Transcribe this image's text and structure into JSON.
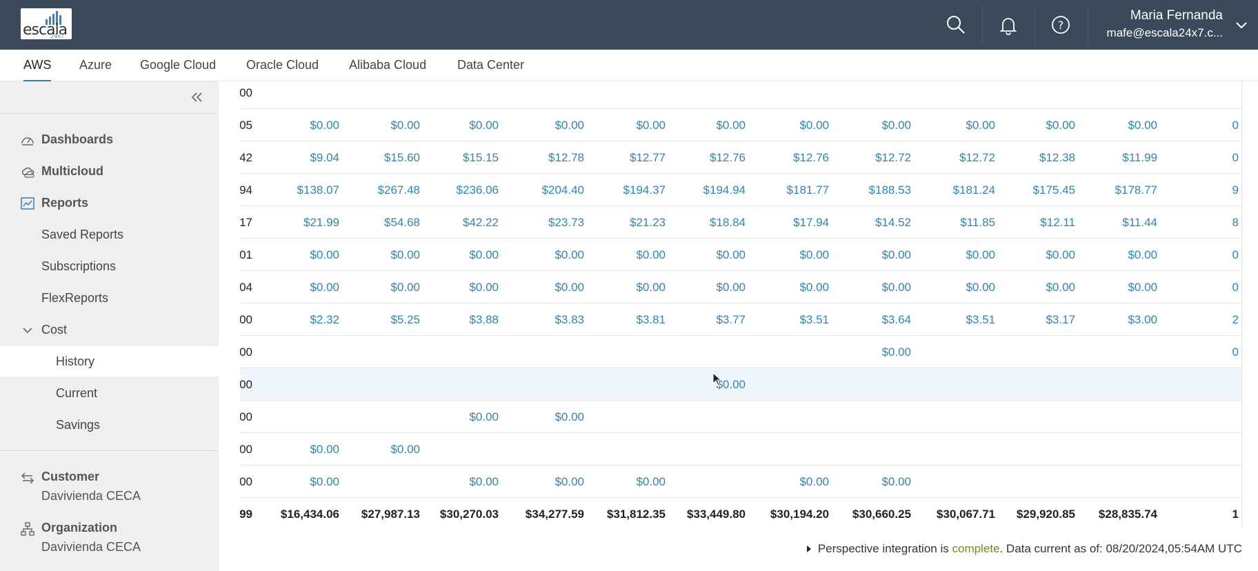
{
  "header": {
    "logo_text": "escala",
    "logo_sub": "24x7",
    "user_name": "Maria Fernanda",
    "user_email": "mafe@escala24x7.c...",
    "icons": [
      "search-icon",
      "bell-icon",
      "help-icon",
      "chevron-down-icon"
    ]
  },
  "tabs": [
    {
      "label": "AWS",
      "active": true
    },
    {
      "label": "Azure"
    },
    {
      "label": "Google Cloud"
    },
    {
      "label": "Oracle Cloud"
    },
    {
      "label": "Alibaba Cloud"
    },
    {
      "label": "Data Center"
    }
  ],
  "sidebar": {
    "items": [
      {
        "label": "Dashboards",
        "icon": "dashboard-icon"
      },
      {
        "label": "Multicloud",
        "icon": "multicloud-icon"
      },
      {
        "label": "Reports",
        "icon": "chart-icon"
      },
      {
        "label": "Saved Reports"
      },
      {
        "label": "Subscriptions"
      },
      {
        "label": "FlexReports"
      },
      {
        "label": "Cost",
        "icon": "chevron-down-icon"
      },
      {
        "label": "History",
        "active": true
      },
      {
        "label": "Current"
      },
      {
        "label": "Savings"
      }
    ],
    "customer": {
      "title": "Customer",
      "value": "Davivienda CECA",
      "icon": "swap-icon"
    },
    "organization": {
      "title": "Organization",
      "value": "Davivienda CECA",
      "icon": "org-icon"
    }
  },
  "table": {
    "rows": [
      [
        "",
        "",
        "",
        "",
        "",
        "",
        "",
        "",
        "",
        "",
        "",
        "",
        "$0.00"
      ],
      [
        "0",
        "$0.00",
        "$0.00",
        "$0.00",
        "$0.00",
        "$0.00",
        "$0.00",
        "$0.00",
        "$0.00",
        "$0.00",
        "$0.00",
        "$0.00",
        "$0.05"
      ],
      [
        "0",
        "$11.99",
        "$12.38",
        "$12.72",
        "$12.72",
        "$12.76",
        "$12.76",
        "$12.77",
        "$12.78",
        "$15.15",
        "$15.60",
        "$9.04",
        "$164.42"
      ],
      [
        "9",
        "$178.77",
        "$175.45",
        "$181.24",
        "$188.53",
        "$181.77",
        "$194.94",
        "$194.37",
        "$204.40",
        "$236.06",
        "$267.48",
        "$138.07",
        "$2,486.94"
      ],
      [
        "8",
        "$11.44",
        "$12.11",
        "$11.85",
        "$14.52",
        "$17.94",
        "$18.84",
        "$21.23",
        "$23.73",
        "$42.22",
        "$54.68",
        "$21.99",
        "$273.17"
      ],
      [
        "0",
        "$0.00",
        "$0.00",
        "$0.00",
        "$0.00",
        "$0.00",
        "$0.00",
        "$0.00",
        "$0.00",
        "$0.00",
        "$0.00",
        "$0.00",
        "$0.01"
      ],
      [
        "0",
        "$0.00",
        "$0.00",
        "$0.00",
        "$0.00",
        "$0.00",
        "$0.00",
        "$0.00",
        "$0.00",
        "$0.00",
        "$0.00",
        "$0.00",
        "$0.04"
      ],
      [
        "2",
        "$3.00",
        "$3.17",
        "$3.51",
        "$3.64",
        "$3.51",
        "$3.77",
        "$3.81",
        "$3.83",
        "$3.88",
        "$5.25",
        "$2.32",
        "$40.00"
      ],
      [
        "0",
        "",
        "",
        "",
        "$0.00",
        "",
        "",
        "",
        "",
        "",
        "",
        "",
        "$0.00"
      ],
      [
        "",
        "",
        "",
        "",
        "",
        "",
        "$0.00",
        "",
        "",
        "",
        "",
        "",
        "$0.00"
      ],
      [
        "",
        "",
        "",
        "",
        "",
        "",
        "",
        "",
        "$0.00",
        "$0.00",
        "",
        "",
        "$0.00"
      ],
      [
        "",
        "",
        "",
        "",
        "",
        "",
        "",
        "",
        "",
        "",
        "$0.00",
        "$0.00",
        "$0.00"
      ],
      [
        "",
        "",
        "",
        "",
        "$0.00",
        "$0.00",
        "",
        "$0.00",
        "$0.00",
        "$0.00",
        "",
        "$0.00",
        "$0.00"
      ]
    ],
    "totals": [
      "1",
      "$28,835.74",
      "$29,920.85",
      "$30,067.71",
      "$30,660.25",
      "$30,194.20",
      "$33,449.80",
      "$31,812.35",
      "$34,277.59",
      "$30,270.03",
      "$27,987.13",
      "$16,434.06",
      "$373,397.99"
    ]
  },
  "status": {
    "prefix": "Perspective integration is",
    "state": "complete",
    "suffix": ". Data current as of: 08/20/2024,05:54AM UTC"
  },
  "colors": {
    "header_bg": "#3b4a5a",
    "accent": "#2e7fb8",
    "link": "#2f84b6",
    "ok": "#6b8e23"
  }
}
